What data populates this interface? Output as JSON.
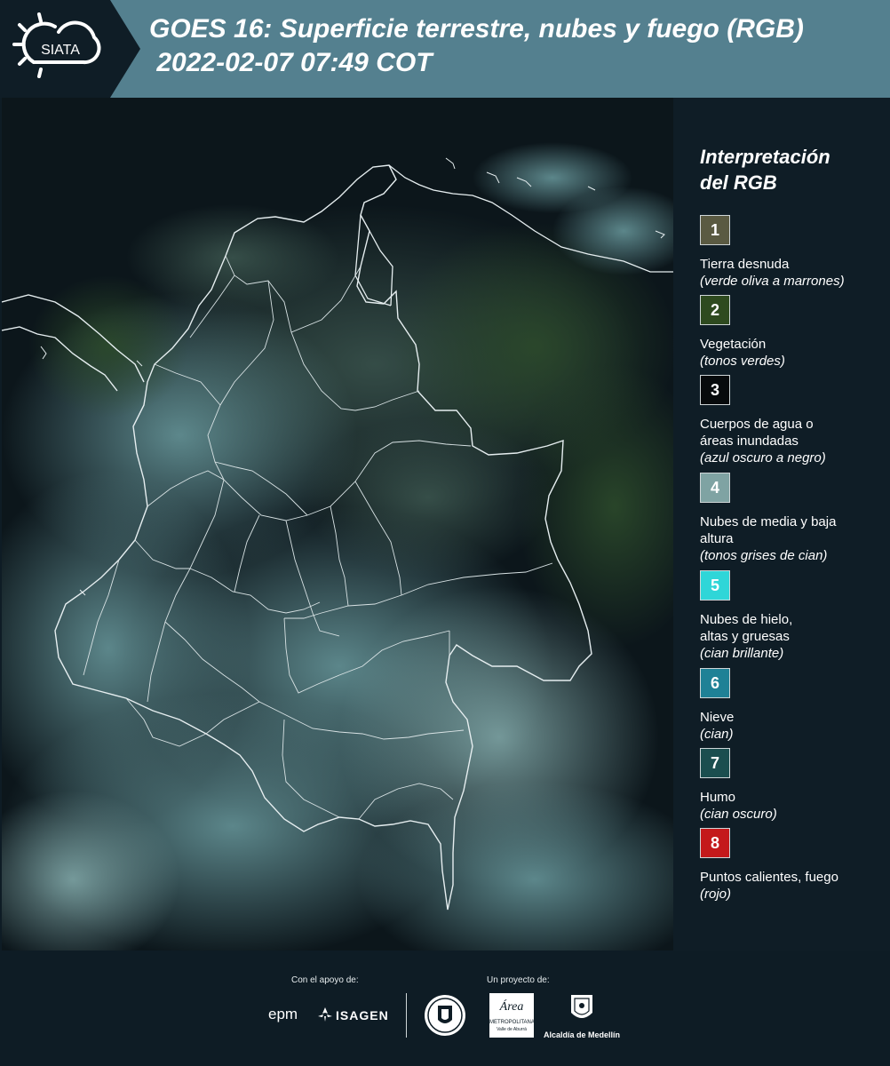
{
  "header": {
    "logo_text": "SIATA",
    "title_line1": "GOES 16: Superficie terrestre, nubes y fuego (RGB)",
    "title_line2": " 2022-02-07 07:49 COT"
  },
  "legend": {
    "title_line1": "Interpretación",
    "title_line2": "del RGB",
    "items": [
      {
        "number": "1",
        "color": "#5a5a42",
        "label": "Tierra desnuda",
        "sub": "(verde oliva a marrones)"
      },
      {
        "number": "2",
        "color": "#2e4a1f",
        "label": "Vegetación",
        "sub": "(tonos verdes)"
      },
      {
        "number": "3",
        "color": "#070a0c",
        "label": "Cuerpos de agua o áreas inundadas",
        "sub": "(azul oscuro a negro)"
      },
      {
        "number": "4",
        "color": "#7fa3a3",
        "label": "Nubes de media y baja altura",
        "sub": "(tonos grises de cian)"
      },
      {
        "number": "5",
        "color": "#2fd6d8",
        "label": "Nubes de hielo, altas y gruesas",
        "sub": "(cian brillante)"
      },
      {
        "number": "6",
        "color": "#1f8196",
        "label": "Nieve",
        "sub": "(cian)"
      },
      {
        "number": "7",
        "color": "#1b4e4f",
        "label": "Humo",
        "sub": "(cian oscuro)"
      },
      {
        "number": "8",
        "color": "#c4191b",
        "label": "Puntos calientes, fuego",
        "sub": "(rojo)"
      }
    ]
  },
  "footer": {
    "support_label": "Con el apoyo de:",
    "project_label": "Un proyecto de:",
    "epm": "epm",
    "isagen": "ISAGEN",
    "area_text": "Área",
    "area_sub1": "METROPOLITANA",
    "area_sub2": "Valle de Aburrá",
    "alcaldia": "Alcaldía de Medellín"
  }
}
